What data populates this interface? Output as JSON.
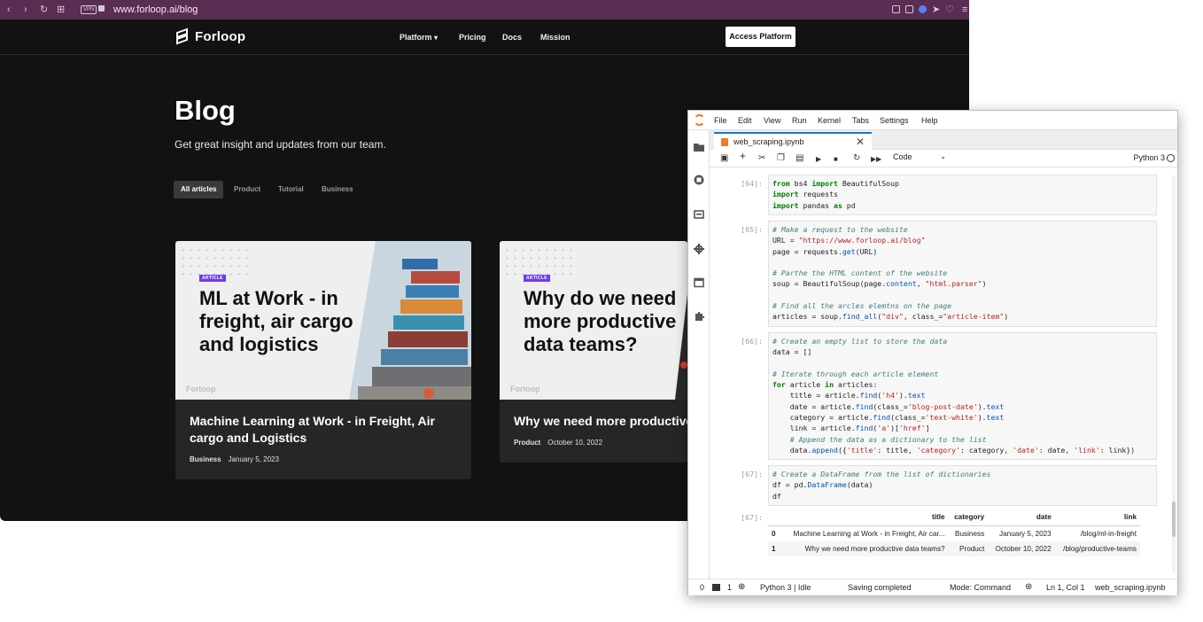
{
  "browser": {
    "url": "www.forloop.ai/blog",
    "vpn_label": "VPN"
  },
  "site": {
    "logo_text": "Forloop",
    "nav": {
      "platform": "Platform",
      "pricing": "Pricing",
      "docs": "Docs",
      "mission": "Mission",
      "platform_chevron": "⌄"
    },
    "cta_label": "Access Platform",
    "blog_title": "Blog",
    "blog_subtitle": "Get great insight and updates from our team.",
    "filters": [
      "All articles",
      "Product",
      "Tutorial",
      "Business"
    ],
    "cards": [
      {
        "badge": "ARTICLE",
        "hero_title": "ML at Work - in freight, air cargo and logistics",
        "hero_logo": "Forloop",
        "title": "Machine Learning at Work - in Freight, Air cargo and Logistics",
        "category": "Business",
        "date": "January 5, 2023"
      },
      {
        "badge": "ARTICLE",
        "hero_title": "Why do we need more productive data teams?",
        "hero_logo": "Forloop",
        "title": "Why we need more productive",
        "category": "Product",
        "date": "October 10, 2022"
      }
    ]
  },
  "jupyter": {
    "menu": [
      "File",
      "Edit",
      "View",
      "Run",
      "Kernel",
      "Tabs",
      "Settings",
      "Help"
    ],
    "tab_name": "web_scraping.ipynb",
    "tab_close": "✕",
    "cell_type": "Code",
    "kernel": "Python 3",
    "cells": [
      {
        "prompt": "[64]:"
      },
      {
        "prompt": "[65]:"
      },
      {
        "prompt": "[66]:"
      },
      {
        "prompt": "[67]:"
      }
    ],
    "output_prompt": "[67]:",
    "table": {
      "columns": [
        "",
        "title",
        "category",
        "date",
        "link"
      ],
      "rows": [
        {
          "index": "0",
          "title": "Machine Learning at Work - in Freight, Air car...",
          "category": "Business",
          "date": "January 5, 2023",
          "link": "/blog/ml-in-freight"
        },
        {
          "index": "1",
          "title": "Why we need more productive data teams?",
          "category": "Product",
          "date": "October 10, 2022",
          "link": "/blog/productive-teams"
        }
      ]
    },
    "status": {
      "zero": "0",
      "one": "1",
      "kernel_state": "Python 3 | Idle",
      "saving": "Saving completed",
      "mode": "Mode: Command",
      "position": "Ln 1, Col 1",
      "file": "web_scraping.ipynb"
    }
  }
}
